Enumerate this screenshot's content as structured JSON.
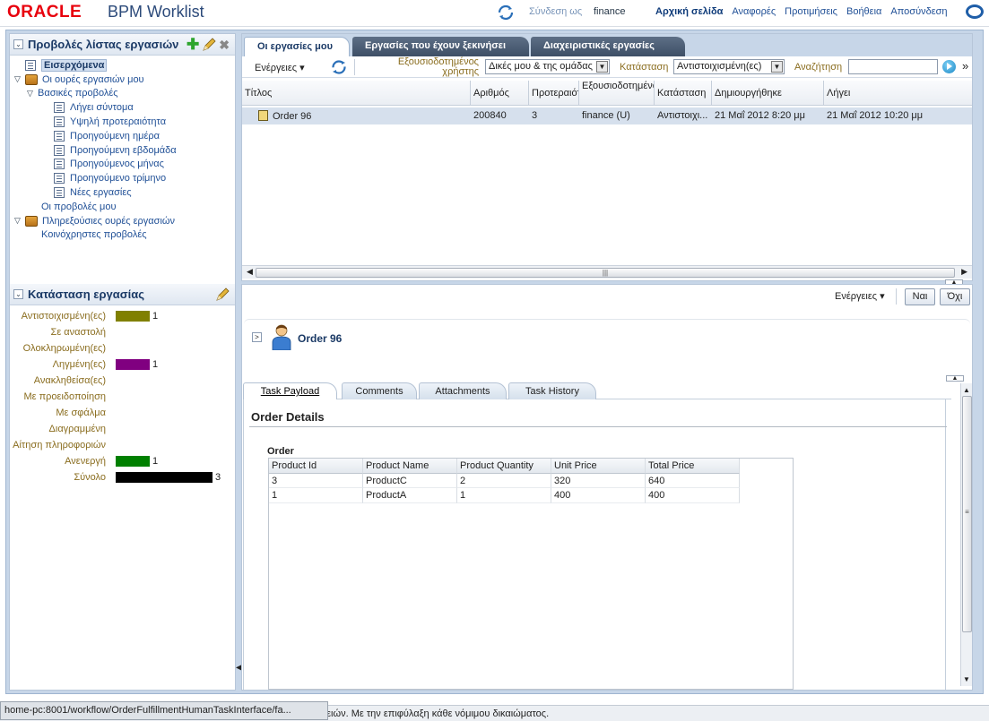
{
  "header": {
    "logo": "ORACLE",
    "app_title": "BPM Worklist",
    "login_label": "Σύνδεση ως",
    "user": "finance",
    "nav": [
      "Αρχική σελίδα",
      "Αναφορές",
      "Προτιμήσεις",
      "Βοήθεια",
      "Αποσύνδεση"
    ]
  },
  "views_panel": {
    "title": "Προβολές λίστας εργασιών",
    "items": [
      {
        "label": "Εισερχόμενα",
        "level": 0
      },
      {
        "label": "Οι ουρές εργασιών μου",
        "level": 0
      },
      {
        "label": "Βασικές προβολές",
        "level": 1
      },
      {
        "label": "Λήγει σύντομα",
        "level": 2
      },
      {
        "label": "Υψηλή προτεραιότητα",
        "level": 2
      },
      {
        "label": "Προηγούμενη ημέρα",
        "level": 2
      },
      {
        "label": "Προηγούμενη εβδομάδα",
        "level": 2
      },
      {
        "label": "Προηγούμενος μήνας",
        "level": 2
      },
      {
        "label": "Προηγούμενο τρίμηνο",
        "level": 2
      },
      {
        "label": "Νέες εργασίες",
        "level": 2
      },
      {
        "label": "Οι προβολές μου",
        "level": 1
      },
      {
        "label": "Πληρεξούσιες ουρές εργασιών",
        "level": 0
      },
      {
        "label": "Κοινόχρηστες προβολές",
        "level": 1
      }
    ]
  },
  "status_panel": {
    "title": "Κατάσταση εργασίας",
    "rows": [
      {
        "label": "Αντιστοιχισμένη(ες)",
        "count": "1",
        "value": 1,
        "color": "#808000"
      },
      {
        "label": "Σε αναστολή",
        "count": "",
        "value": 0,
        "color": ""
      },
      {
        "label": "Ολοκληρωμένη(ες)",
        "count": "",
        "value": 0,
        "color": ""
      },
      {
        "label": "Ληγμένη(ες)",
        "count": "1",
        "value": 1,
        "color": "#800080"
      },
      {
        "label": "Ανακληθείσα(ες)",
        "count": "",
        "value": 0,
        "color": ""
      },
      {
        "label": "Με προειδοποίηση",
        "count": "",
        "value": 0,
        "color": ""
      },
      {
        "label": "Με σφάλμα",
        "count": "",
        "value": 0,
        "color": ""
      },
      {
        "label": "Διαγραμμένη",
        "count": "",
        "value": 0,
        "color": ""
      },
      {
        "label": "Αίτηση πληροφοριών",
        "count": "",
        "value": 0,
        "color": ""
      },
      {
        "label": "Ανενεργή",
        "count": "1",
        "value": 1,
        "color": "#008000"
      },
      {
        "label": "Σύνολο",
        "count": "3",
        "value": 3,
        "color": "#000000"
      }
    ]
  },
  "task_tabs": [
    "Οι εργασίες μου",
    "Εργασίες που έχουν ξεκινήσει",
    "Διαχειριστικές εργασίες"
  ],
  "toolbar": {
    "actions": "Ενέργειες ▾",
    "assignee_label": "Εξουσιοδοτημένος χρήστης",
    "assignee_value": "Δικές μου & της ομάδας",
    "status_label": "Κατάσταση",
    "status_value": "Αντιστοιχισμένη(ες)",
    "search_label": "Αναζήτηση",
    "search_value": ""
  },
  "task_grid": {
    "headers": [
      "Τίτλος",
      "Αριθμός",
      "Προτεραιότ",
      "Εξουσιοδοτημένο χρήστης",
      "Κατάσταση",
      "Δημιουργήθηκε",
      "Λήγει"
    ],
    "rows": [
      [
        "Order 96",
        "200840",
        "3",
        "finance (U)",
        "Αντιστοιχι...",
        "21 Μαΐ 2012 8:20 μμ",
        "21 Μαΐ 2012 10:20 μμ"
      ]
    ]
  },
  "detail": {
    "actions": "Ενέργειες ▾",
    "yes": "Ναι",
    "no": "Όχι",
    "order_title": "Order 96",
    "tabs": [
      "Task Payload",
      "Comments",
      "Attachments",
      "Task History"
    ],
    "section_title": "Order Details",
    "table_label": "Order",
    "table_headers": [
      "Product Id",
      "Product Name",
      "Product Quantity",
      "Unit Price",
      "Total Price"
    ],
    "table_rows": [
      [
        "3",
        "ProductC",
        "2",
        "320",
        "640"
      ],
      [
        "1",
        "ProductA",
        "1",
        "400",
        "400"
      ]
    ]
  },
  "footer": {
    "copyright": "εταιρειών. Με την επιφύλαξη κάθε νόμιμου δικαιώματος.",
    "status_url": "home-pc:8001/workflow/OrderFulfillmentHumanTaskInterface/fa..."
  }
}
